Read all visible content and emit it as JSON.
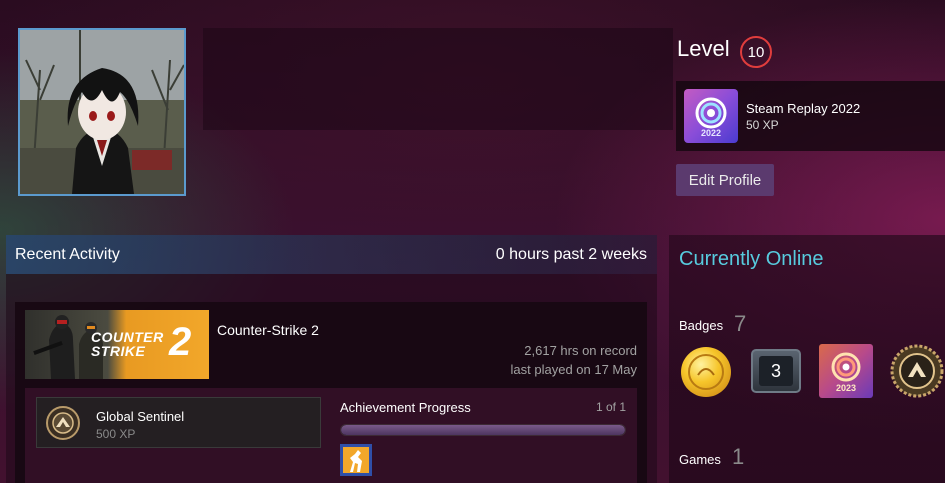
{
  "profile": {
    "level_label": "Level",
    "level_value": "10",
    "favorite_badge": {
      "name": "Steam Replay 2022",
      "xp": "50 XP",
      "year": "2022"
    },
    "edit_profile_label": "Edit Profile"
  },
  "recent_activity": {
    "title": "Recent Activity",
    "hours_summary": "0 hours past 2 weeks",
    "game": {
      "name": "Counter-Strike 2",
      "capsule_text_line1": "COUNTER",
      "capsule_text_line2": "STRIKE",
      "capsule_text_2": "2",
      "hours_on_record": "2,617 hrs on record",
      "last_played": "last played on 17 May",
      "achievement": {
        "name": "Global Sentinel",
        "xp": "500 XP"
      },
      "achievement_progress_label": "Achievement Progress",
      "achievement_progress_count": "1 of 1",
      "achievement_progress_fraction": 1.0
    }
  },
  "sidebar": {
    "status": "Currently Online",
    "badges_label": "Badges",
    "badges_count": "7",
    "badge_3_value": "3",
    "badge_replay_year": "2023",
    "games_label": "Games",
    "games_count": "1"
  },
  "colors": {
    "online_status": "#57cbde",
    "level_ring": "#e03d3d",
    "edit_button": "#5b3a6e",
    "avatar_border": "#5b9ace"
  }
}
